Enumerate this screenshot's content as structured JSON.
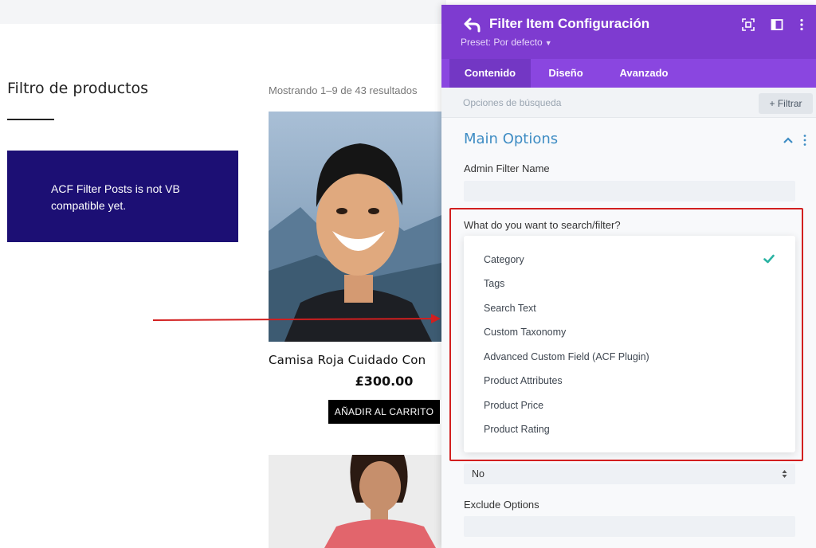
{
  "page": {
    "widget_title": "Filtro de productos",
    "acf_notice": "ACF Filter Posts is not VB compatible yet.",
    "results_count": "Mostrando 1–9 de 43 resultados",
    "product": {
      "name": "Camisa Roja Cuidado Con",
      "price": "£300.00",
      "add_to_cart": "AÑADIR AL CARRITO"
    }
  },
  "panel": {
    "title": "Filter Item Configuración",
    "preset": "Preset: Por defecto",
    "header_icons": [
      "expand-icon",
      "split-view-icon",
      "more-vertical-icon"
    ],
    "tabs": [
      {
        "label": "Contenido",
        "active": true
      },
      {
        "label": "Diseño",
        "active": false
      },
      {
        "label": "Avanzado",
        "active": false
      }
    ],
    "search": {
      "placeholder": "Opciones de búsqueda",
      "filter_label": "Filtrar"
    },
    "section": {
      "title": "Main Options",
      "admin_filter_name_label": "Admin Filter Name",
      "admin_filter_name_value": "",
      "search_filter_label": "What do you want to search/filter?",
      "options": [
        {
          "label": "Category",
          "selected": true
        },
        {
          "label": "Tags",
          "selected": false
        },
        {
          "label": "Search Text",
          "selected": false
        },
        {
          "label": "Custom Taxonomy",
          "selected": false
        },
        {
          "label": "Advanced Custom Field (ACF Plugin)",
          "selected": false
        },
        {
          "label": "Product Attributes",
          "selected": false
        },
        {
          "label": "Product Price",
          "selected": false
        },
        {
          "label": "Product Rating",
          "selected": false
        }
      ],
      "select_value": "No",
      "exclude_options_label": "Exclude Options",
      "exclude_options_value": ""
    }
  },
  "colors": {
    "panel_header": "#7e3bd0",
    "tabs_bar": "#8a46e0",
    "acf_box": "#1c0f74",
    "section_title": "#3f8dc4",
    "check": "#2bb3a3",
    "annotation_red": "#d21f1f"
  }
}
